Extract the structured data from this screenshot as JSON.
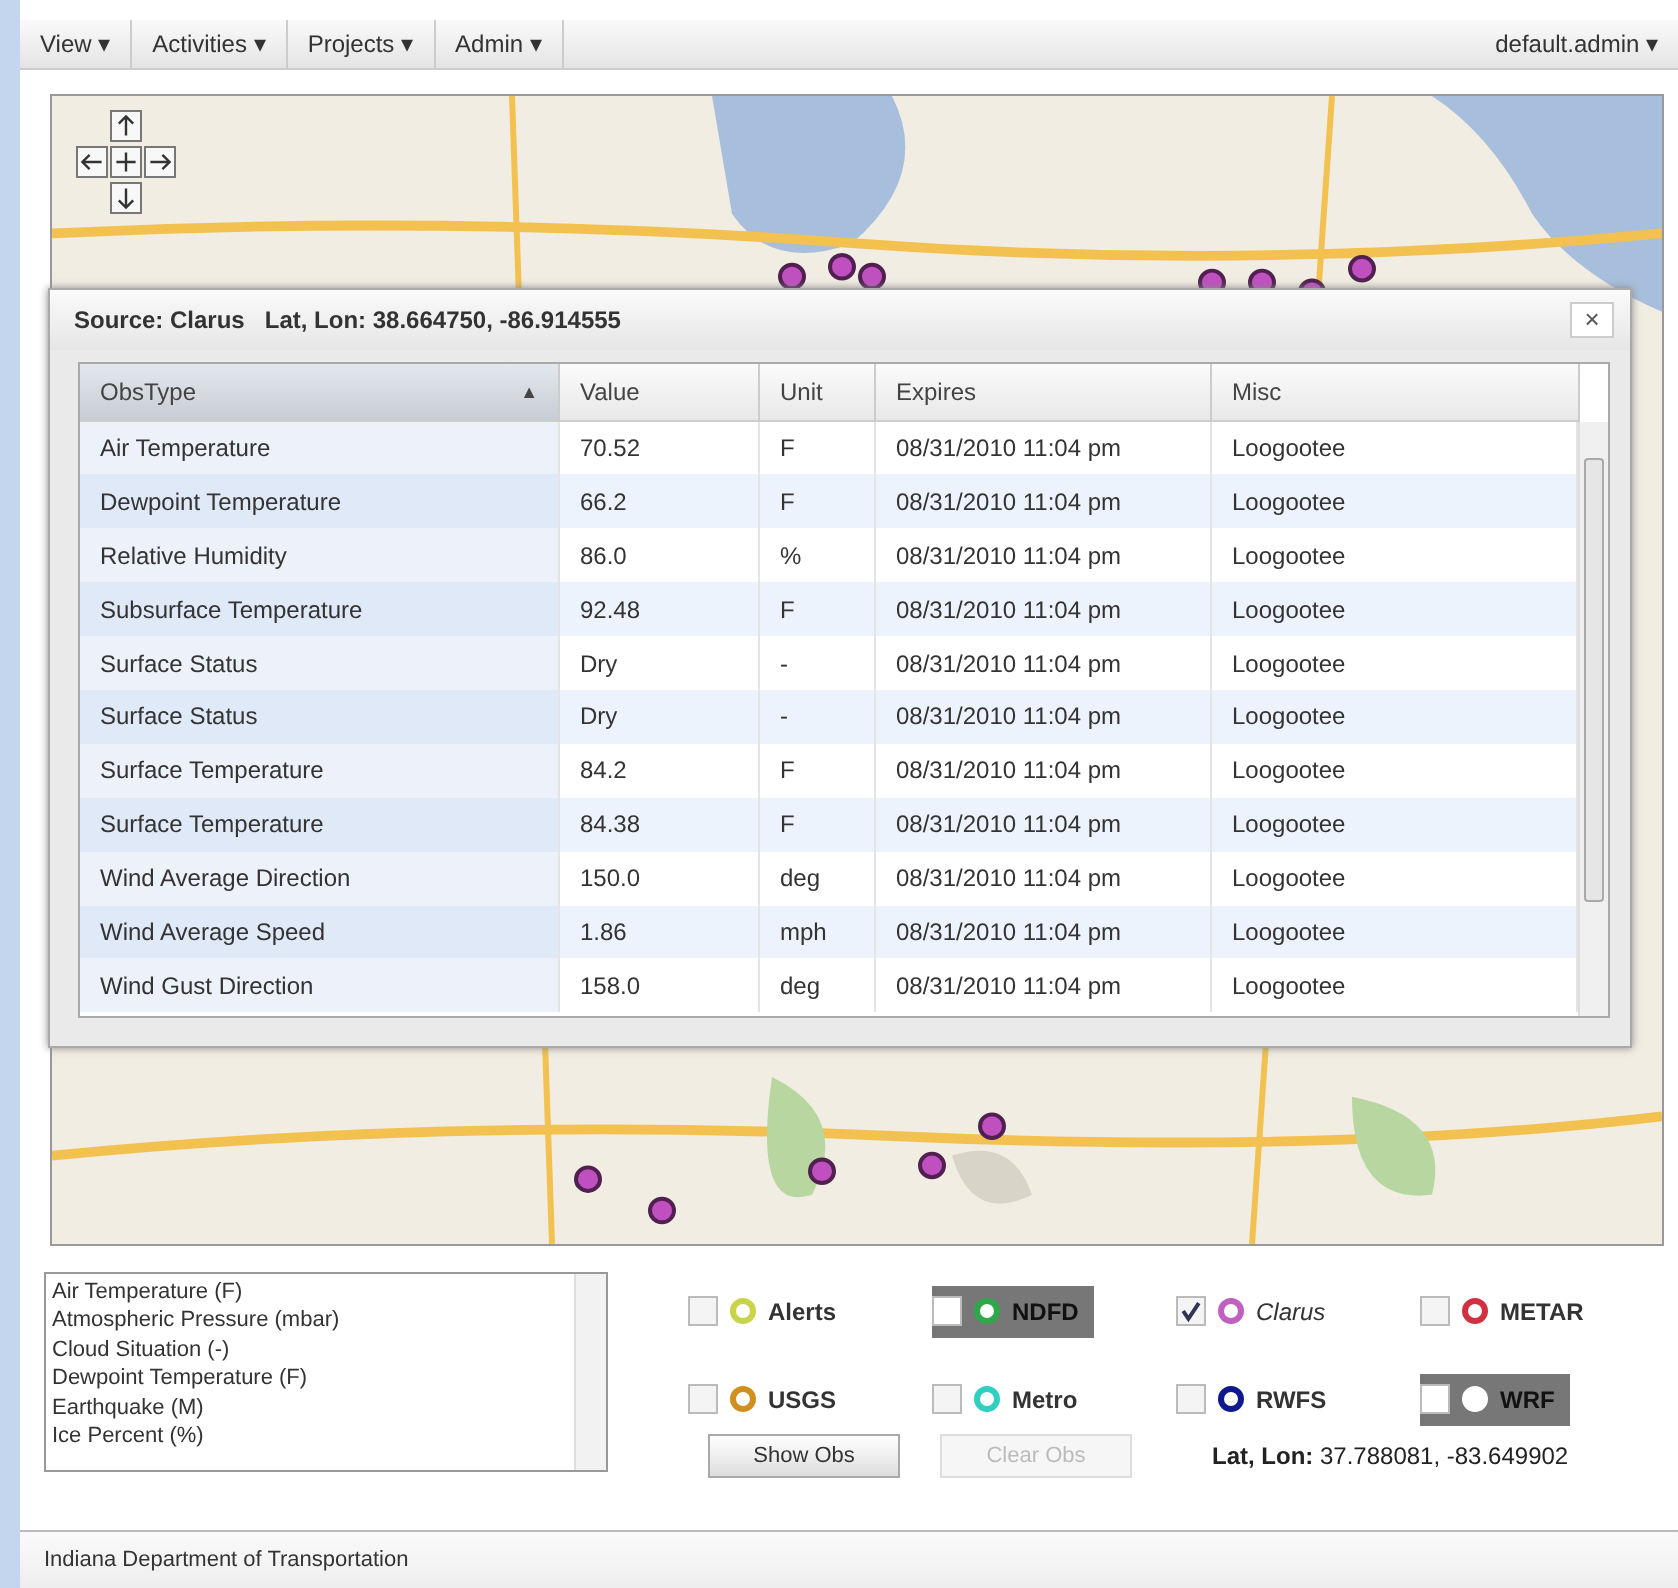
{
  "menu": [
    {
      "label": "View ▾"
    },
    {
      "label": "Activities ▾"
    },
    {
      "label": "Projects ▾"
    },
    {
      "label": "Admin ▾"
    }
  ],
  "user_menu": "default.admin ▾",
  "dialog": {
    "source_label": "Source:",
    "source": "Clarus",
    "latlon_label": "Lat, Lon:",
    "latlon": "38.664750, -86.914555",
    "close": "×",
    "columns": [
      {
        "label": "ObsType",
        "sorted": true,
        "sort_arrow": "▲"
      },
      {
        "label": "Value",
        "sorted": false
      },
      {
        "label": "Unit",
        "sorted": false
      },
      {
        "label": "Expires",
        "sorted": false
      },
      {
        "label": "Misc",
        "sorted": false
      }
    ],
    "rows": [
      [
        "Air Temperature",
        "70.52",
        "F",
        "08/31/2010 11:04 pm",
        "Loogootee"
      ],
      [
        "Dewpoint Temperature",
        "66.2",
        "F",
        "08/31/2010 11:04 pm",
        "Loogootee"
      ],
      [
        "Relative Humidity",
        "86.0",
        "%",
        "08/31/2010 11:04 pm",
        "Loogootee"
      ],
      [
        "Subsurface Temperature",
        "92.48",
        "F",
        "08/31/2010 11:04 pm",
        "Loogootee"
      ],
      [
        "Surface Status",
        "Dry",
        "-",
        "08/31/2010 11:04 pm",
        "Loogootee"
      ],
      [
        "Surface Status",
        "Dry",
        "-",
        "08/31/2010 11:04 pm",
        "Loogootee"
      ],
      [
        "Surface Temperature",
        "84.2",
        "F",
        "08/31/2010 11:04 pm",
        "Loogootee"
      ],
      [
        "Surface Temperature",
        "84.38",
        "F",
        "08/31/2010 11:04 pm",
        "Loogootee"
      ],
      [
        "Wind Average Direction",
        "150.0",
        "deg",
        "08/31/2010 11:04 pm",
        "Loogootee"
      ],
      [
        "Wind Average Speed",
        "1.86",
        "mph",
        "08/31/2010 11:04 pm",
        "Loogootee"
      ],
      [
        "Wind Gust Direction",
        "158.0",
        "deg",
        "08/31/2010 11:04 pm",
        "Loogootee"
      ]
    ]
  },
  "obs_list": [
    "Air Temperature (F)",
    "Atmospheric Pressure (mbar)",
    "Cloud Situation (-)",
    "Dewpoint Temperature (F)",
    "Earthquake (M)",
    "Ice Percent (%)"
  ],
  "layers": [
    {
      "label": "Alerts",
      "checked": false,
      "color": "#c8d44a",
      "highlighted": false
    },
    {
      "label": "NDFD",
      "checked": false,
      "color": "#2fa84a",
      "highlighted": true
    },
    {
      "label": "Clarus",
      "checked": true,
      "color": "#c060c0",
      "highlighted": false
    },
    {
      "label": "METAR",
      "checked": false,
      "color": "#d03040",
      "highlighted": false
    },
    {
      "label": "USGS",
      "checked": false,
      "color": "#d09020",
      "highlighted": false
    },
    {
      "label": "Metro",
      "checked": false,
      "color": "#30d0c0",
      "highlighted": false
    },
    {
      "label": "RWFS",
      "checked": false,
      "color": "#101890",
      "highlighted": false
    },
    {
      "label": "WRF",
      "checked": false,
      "color": "#ffffff",
      "highlighted": true
    }
  ],
  "buttons": [
    {
      "label": "Show Obs",
      "disabled": false
    },
    {
      "label": "Clear Obs",
      "disabled": true
    }
  ],
  "cursor": {
    "label": "Lat, Lon:",
    "value": "37.788081, -83.649902"
  },
  "status_bar": "Indiana Department of Transportation"
}
